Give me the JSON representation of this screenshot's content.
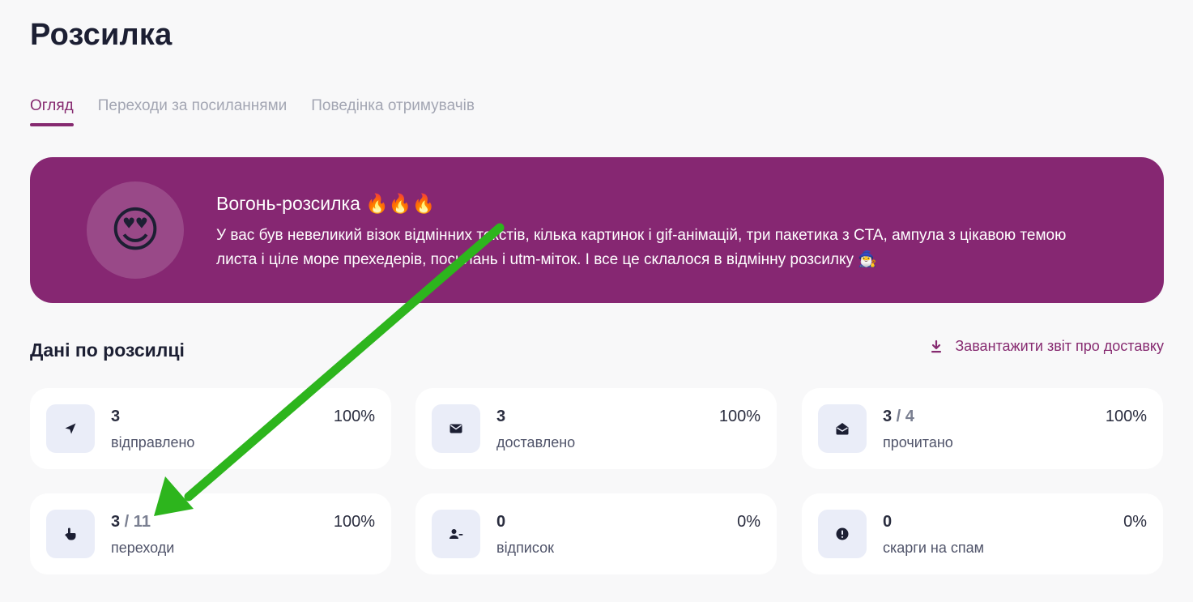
{
  "page_title": "Розсилка",
  "tabs": [
    {
      "label": "Огляд",
      "active": true
    },
    {
      "label": "Переходи за посиланнями",
      "active": false
    },
    {
      "label": "Поведінка отримувачів",
      "active": false
    }
  ],
  "banner": {
    "emoji": "😍",
    "title": "Вогонь-розсилка 🔥🔥🔥",
    "text": "У вас був невеликий візок відмінних текстів, кілька картинок і gif-анімацій, три пакетика з CTA, ампула з цікавою темою листа і ціле море прехедерів, посилань і utm-міток. І все це склалося в відмінну розсилку 🧙‍♂️",
    "color": "#862772"
  },
  "section": {
    "title": "Дані по розсилці",
    "download_label": "Завантажити звіт про доставку"
  },
  "stats": [
    {
      "icon": "send-icon",
      "value": "3",
      "total": "",
      "label": "відправлено",
      "percent": "100%"
    },
    {
      "icon": "envelope-icon",
      "value": "3",
      "total": "",
      "label": "доставлено",
      "percent": "100%"
    },
    {
      "icon": "open-envelope-icon",
      "value": "3",
      "total": " / 4",
      "label": "прочитано",
      "percent": "100%"
    },
    {
      "icon": "pointer-hand-icon",
      "value": "3",
      "total": " / 11",
      "label": "переходи",
      "percent": "100%"
    },
    {
      "icon": "user-minus-icon",
      "value": "0",
      "total": "",
      "label": "відписок",
      "percent": "0%"
    },
    {
      "icon": "alert-circle-icon",
      "value": "0",
      "total": "",
      "label": "скарги на спам",
      "percent": "0%"
    }
  ],
  "colors": {
    "accent": "#862a70",
    "arrow": "#2db51d",
    "icon_bg": "#eaedf8"
  }
}
